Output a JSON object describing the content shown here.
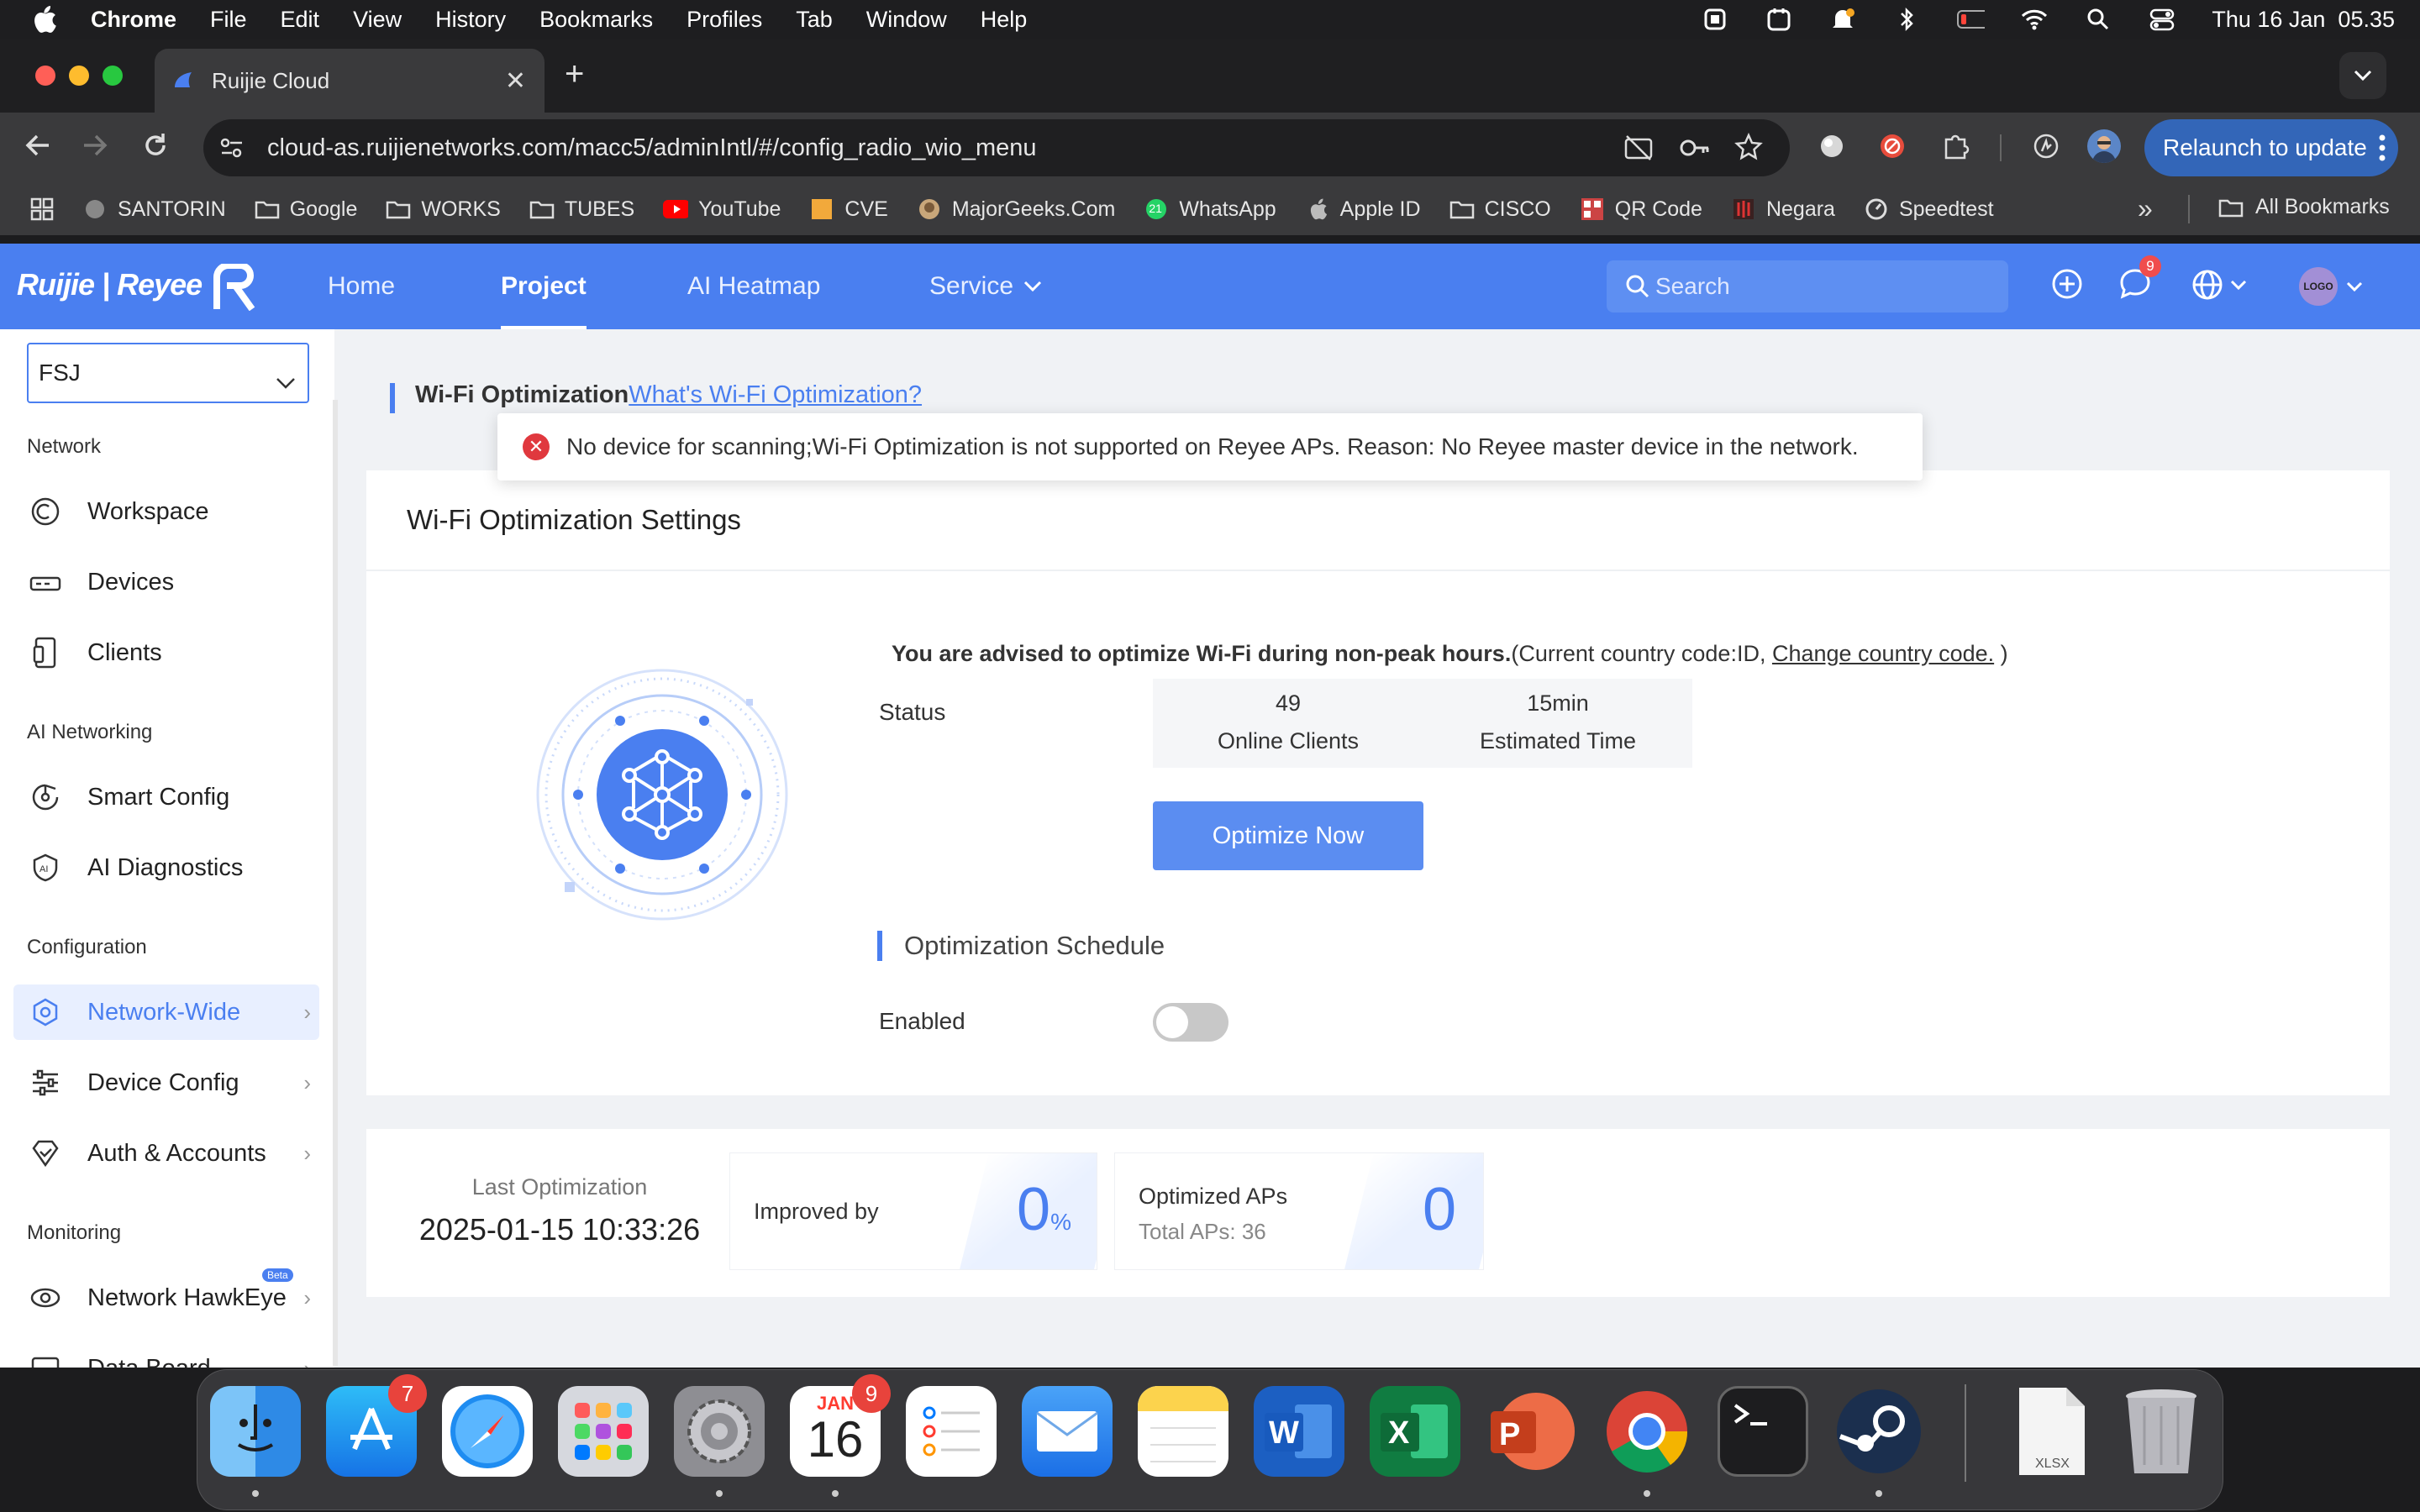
{
  "menubar": {
    "app": "Chrome",
    "items": [
      "File",
      "Edit",
      "View",
      "History",
      "Bookmarks",
      "Profiles",
      "Tab",
      "Window",
      "Help"
    ],
    "clock": "Thu 16 Jan  05.35"
  },
  "browser": {
    "tab_title": "Ruijie Cloud",
    "url": "cloud-as.ruijienetworks.com/macc5/adminIntl/#/config_radio_wio_menu",
    "relaunch_label": "Relaunch to update",
    "bookmarks": [
      "SANTORIN",
      "Google",
      "WORKS",
      "TUBES",
      "YouTube",
      "CVE",
      "MajorGeeks.Com",
      "WhatsApp",
      "Apple ID",
      "CISCO",
      "QR Code",
      "Negara",
      "Speedtest"
    ],
    "all_bookmarks": "All Bookmarks",
    "whatsapp_badge": "21"
  },
  "app": {
    "logo": "Ruijie | Reyee",
    "nav": {
      "home": "Home",
      "project": "Project",
      "heatmap": "AI Heatmap",
      "service": "Service"
    },
    "search_placeholder": "Search",
    "message_count": "9",
    "avatar": "LOGO"
  },
  "sidebar": {
    "project": "FSJ",
    "sections": {
      "network": "Network",
      "ai": "AI Networking",
      "config": "Configuration",
      "monitoring": "Monitoring"
    },
    "items": {
      "workspace": "Workspace",
      "devices": "Devices",
      "clients": "Clients",
      "smart_config": "Smart Config",
      "ai_diagnostics": "AI Diagnostics",
      "network_wide": "Network-Wide",
      "device_config": "Device Config",
      "auth_accounts": "Auth & Accounts",
      "hawkeye": "Network HawkEye",
      "databoard": "Data Board"
    },
    "beta": "Beta"
  },
  "main": {
    "page_title": "Wi-Fi Optimization",
    "help_link": "What's Wi-Fi Optimization?",
    "toast": "No device for scanning;Wi-Fi Optimization is not supported on Reyee APs. Reason: No Reyee master device in the network.",
    "settings_title": "Wi-Fi Optimization Settings",
    "advice_bold": "You are advised to optimize Wi-Fi during non-peak hours.",
    "advice_country": "(Current country code:ID, ",
    "change_country": "Change country code.",
    "advice_close": " )",
    "status_label": "Status",
    "online_clients_value": "49",
    "online_clients_label": "Online Clients",
    "est_time_value": "15min",
    "est_time_label": "Estimated Time",
    "optimize_button": "Optimize Now",
    "schedule_title": "Optimization Schedule",
    "enabled_label": "Enabled",
    "schedule_enabled": false
  },
  "summary": {
    "last_label": "Last Optimization",
    "last_value": "2025-01-15 10:33:26",
    "improved_label": "Improved by",
    "improved_value": "0",
    "improved_unit": "%",
    "optimized_label": "Optimized APs",
    "total_aps": "Total APs: 36",
    "optimized_value": "0"
  },
  "dock": {
    "appstore_badge": "7",
    "calendar_month": "JAN",
    "calendar_day": "16",
    "calendar_badge": "9",
    "xlsx_label": "XLSX"
  },
  "colors": {
    "accent": "#4a7ff0",
    "error": "#e0383e",
    "button": "#5b8df1"
  }
}
